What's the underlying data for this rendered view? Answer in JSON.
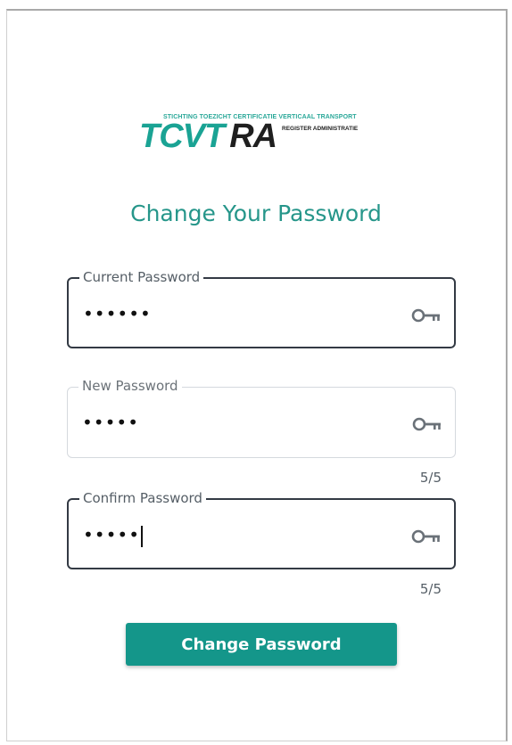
{
  "logo": {
    "tagline": "STICHTING TOEZICHT CERTIFICATIE VERTICAAL TRANSPORT",
    "brand_main": "TCVT",
    "brand_suffix": "RA",
    "subtitle": "REGISTER ADMINISTRATIE"
  },
  "title": "Change Your Password",
  "fields": {
    "current": {
      "label": "Current Password",
      "value": "••••••"
    },
    "new": {
      "label": "New Password",
      "value": "•••••",
      "counter": "5/5"
    },
    "confirm": {
      "label": "Confirm Password",
      "value": "•••••",
      "counter": "5/5"
    }
  },
  "submit_label": "Change Password",
  "colors": {
    "accent": "#14968a",
    "title": "#26968a",
    "active_border": "#333a44"
  }
}
